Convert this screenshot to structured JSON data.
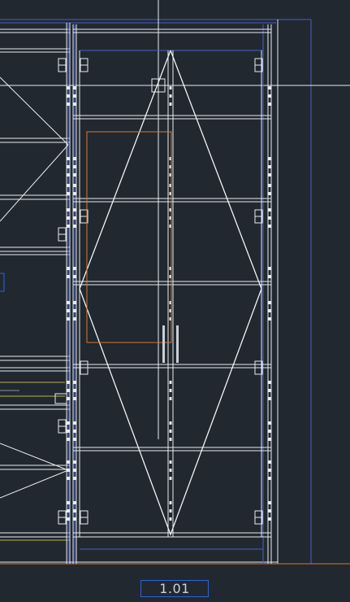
{
  "drawing": {
    "scale_label": "1.01",
    "colors": {
      "background": "#212830",
      "primary_lines": "#e8ecef",
      "frame_lines": "#4b5fbf",
      "accent_blue": "#2f63d6",
      "orange_outline": "#d8782b",
      "floor_line": "#d8782b",
      "hardware": "#c9ced4"
    },
    "icons": [
      "hinge-icon",
      "door-handle-icon",
      "grip-square-icon"
    ]
  }
}
